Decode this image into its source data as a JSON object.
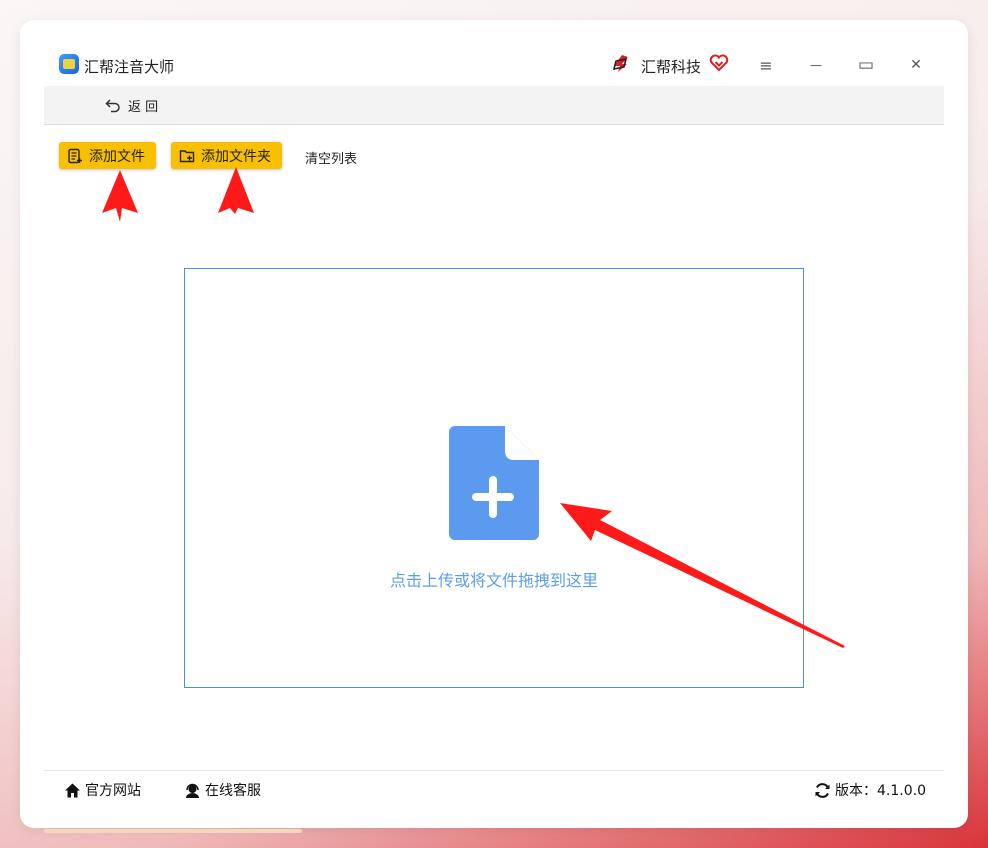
{
  "app": {
    "title": "汇帮注音大师",
    "brand": "汇帮科技"
  },
  "window_controls": {
    "menu": "≡",
    "minimize": "—",
    "maximize": "▭",
    "close": "✕"
  },
  "nav": {
    "back_label": "返 回"
  },
  "toolbar": {
    "add_file": "添加文件",
    "add_folder": "添加文件夹",
    "clear_list": "清空列表"
  },
  "dropzone": {
    "hint": "点击上传或将文件拖拽到这里"
  },
  "statusbar": {
    "site": "官方网站",
    "support": "在线客服",
    "version": "版本：4.1.0.0"
  },
  "colors": {
    "accent": "#f8c000",
    "drop_border": "#4f8fe0",
    "file_icon": "#5b9aee",
    "arrow": "#ff1a1a"
  }
}
